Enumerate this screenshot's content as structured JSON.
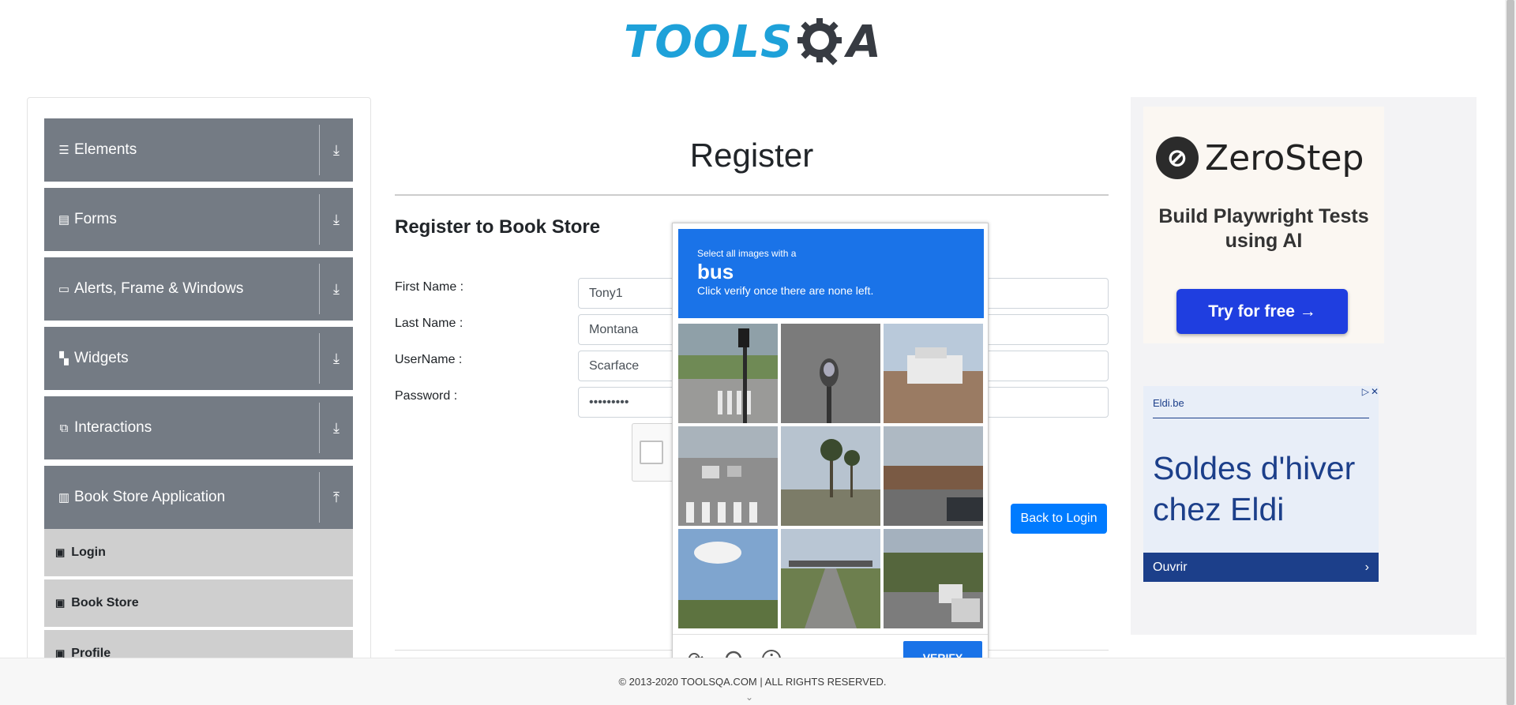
{
  "header": {
    "logo_text": "TOOLS",
    "logo_qa": "QA"
  },
  "sidebar": {
    "groups": [
      {
        "label": "Elements",
        "icon": "list-icon"
      },
      {
        "label": "Forms",
        "icon": "form-icon"
      },
      {
        "label": "Alerts, Frame & Windows",
        "icon": "window-icon"
      },
      {
        "label": "Widgets",
        "icon": "widgets-icon"
      },
      {
        "label": "Interactions",
        "icon": "interactions-icon"
      },
      {
        "label": "Book Store Application",
        "icon": "books-icon"
      }
    ],
    "subitems": [
      {
        "label": "Login"
      },
      {
        "label": "Book Store"
      },
      {
        "label": "Profile"
      }
    ]
  },
  "main": {
    "title": "Register",
    "subtitle": "Register to Book Store",
    "fields": [
      {
        "label": "First Name :",
        "value": "Tony1"
      },
      {
        "label": "Last Name :",
        "value": "Montana"
      },
      {
        "label": "UserName :",
        "value": "Scarface"
      },
      {
        "label": "Password :",
        "value": "•••••••••"
      }
    ],
    "back_button": "Back to Login"
  },
  "captcha": {
    "instruction_small": "Select all images with a",
    "target": "bus",
    "hint": "Click verify once there are none left.",
    "verify_label": "VERIFY"
  },
  "ads": {
    "zerostep": {
      "brand": "ZeroStep",
      "tagline": "Build Playwright Tests using AI",
      "button": "Try for free →"
    },
    "eldi": {
      "source": "Eldi.be",
      "headline": "Soldes d'hiver chez Eldi",
      "cta": "Ouvrir"
    }
  },
  "footer": {
    "text": "© 2013-2020 TOOLSQA.COM | ALL RIGHTS RESERVED."
  },
  "colors": {
    "sidebar_group": "#747b84",
    "sidebar_sub": "#cfcfcf",
    "primary": "#007bff",
    "captcha_blue": "#1a73e8",
    "logo_blue": "#1ea1d9"
  }
}
